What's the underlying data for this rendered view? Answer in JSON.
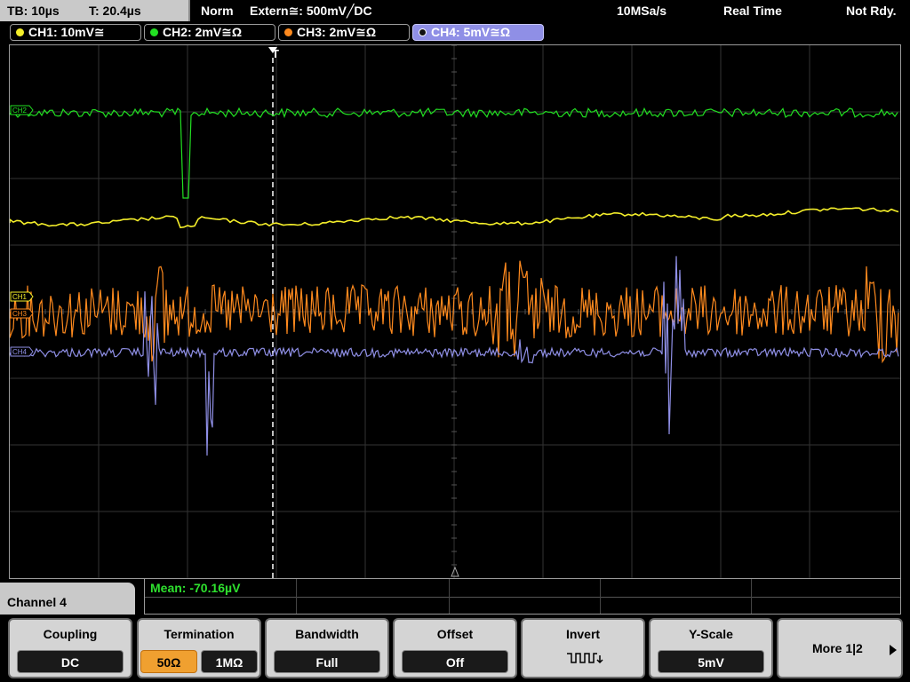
{
  "status_bar": {
    "timebase": "TB: 10µs",
    "trigger_time": "T: 20.4µs",
    "mode": "Norm",
    "trigger_source": "Extern≅: 500mV╱DC",
    "sample_rate": "10MSa/s",
    "acquisition": "Real Time",
    "status": "Not Rdy."
  },
  "channels": [
    {
      "label": "CH1: 10mV≅",
      "color": "#f4ee2a",
      "active": false
    },
    {
      "label": "CH2: 2mV≅Ω",
      "color": "#22e022",
      "active": false
    },
    {
      "label": "CH3: 2mV≅Ω",
      "color": "#ff8a1e",
      "active": false
    },
    {
      "label": "CH4: 5mV≅Ω",
      "color": "#8f8fe6",
      "active": true
    }
  ],
  "markers": {
    "trigger": "T",
    "ch2": "CH2",
    "ch1": "CH1",
    "ch3": "CH3",
    "ch4": "CH4"
  },
  "measurement": {
    "mean": "Mean: -70.16µV"
  },
  "menu": {
    "title": "Channel 4",
    "coupling": {
      "label": "Coupling",
      "value": "DC"
    },
    "termination": {
      "label": "Termination",
      "option_a": "50Ω",
      "option_b": "1MΩ",
      "selected": "50Ω"
    },
    "bandwidth": {
      "label": "Bandwidth",
      "value": "Full"
    },
    "offset": {
      "label": "Offset",
      "value": "Off"
    },
    "invert": {
      "label": "Invert",
      "icon": "invert-waveform-icon"
    },
    "yscale": {
      "label": "Y-Scale",
      "value": "5mV"
    },
    "more": {
      "label": "More 1|2",
      "icon": "arrow-right-icon"
    }
  },
  "colors": {
    "ch1": "#f4ee2a",
    "ch2": "#22e022",
    "ch3": "#ff8a1e",
    "ch4": "#8f8fe6",
    "grid": "#3a3a3a",
    "softkey_bg": "#d4d4d4",
    "selected_option": "#f0a030"
  }
}
